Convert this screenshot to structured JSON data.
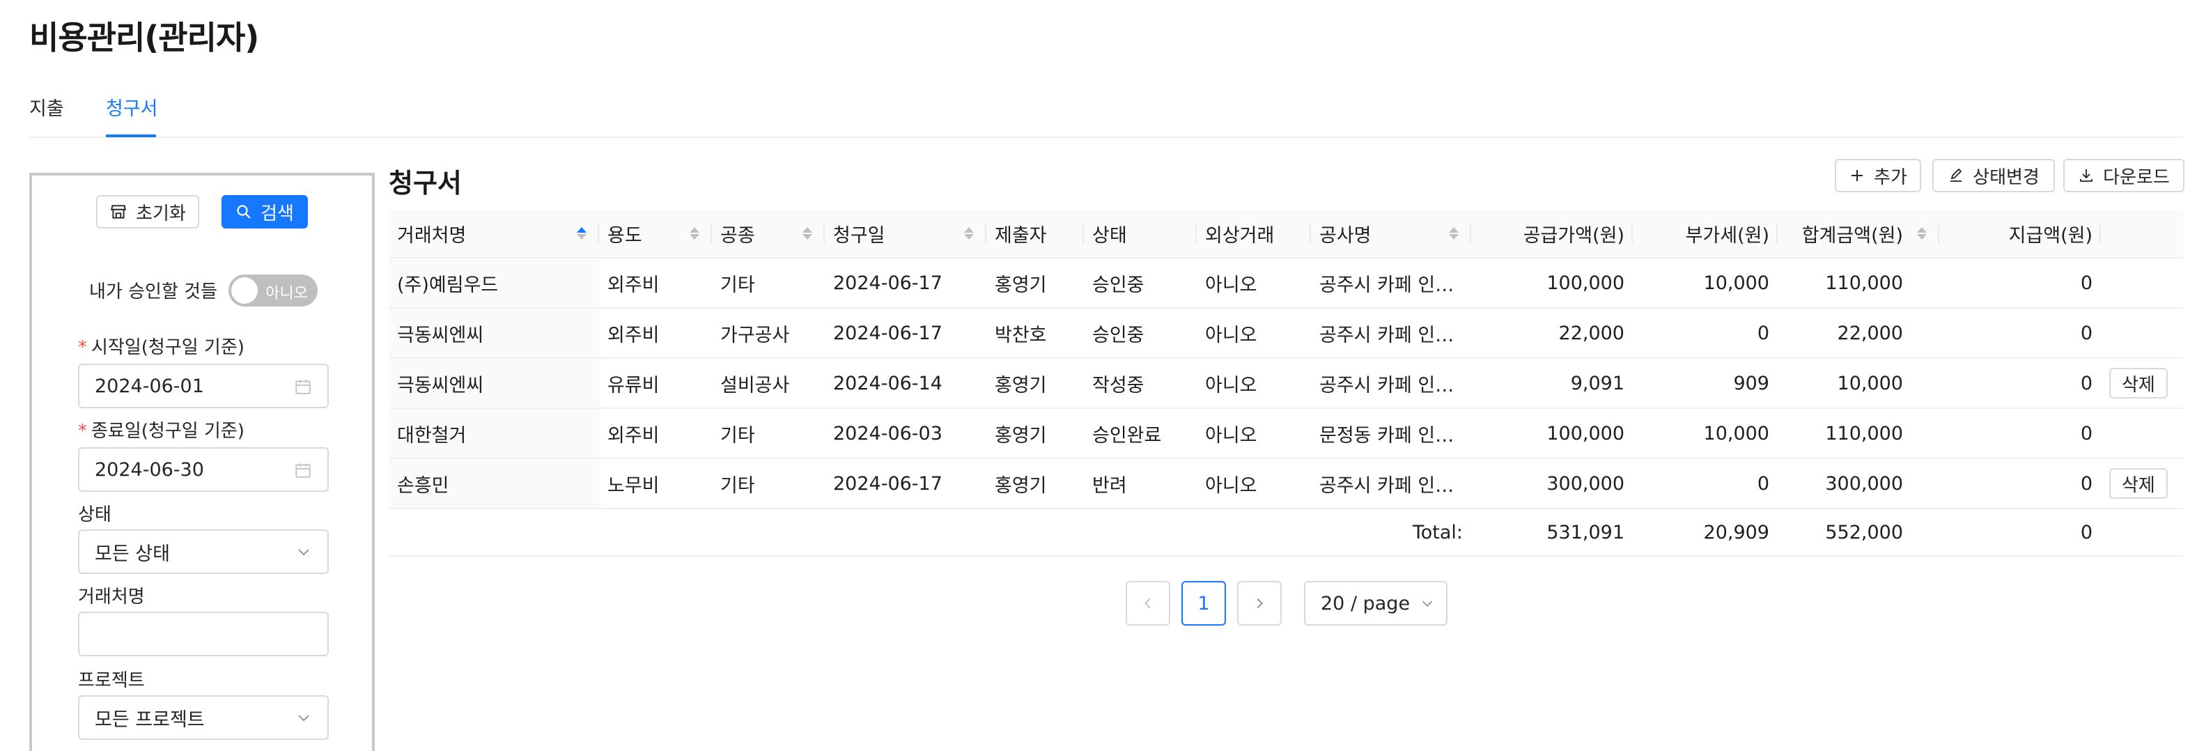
{
  "page": {
    "title": "비용관리(관리자)"
  },
  "tabs": [
    {
      "label": "지출"
    },
    {
      "label": "청구서"
    }
  ],
  "filters": {
    "reset_label": "초기화",
    "search_label": "검색",
    "my_approval_label": "내가 승인할 것들",
    "my_approval_toggle": "아니오",
    "start_label": "시작일(청구일 기준)",
    "start_value": "2024-06-01",
    "end_label": "종료일(청구일 기준)",
    "end_value": "2024-06-30",
    "status_label": "상태",
    "status_value": "모든 상태",
    "vendor_label": "거래처명",
    "vendor_value": "",
    "project_label": "프로젝트",
    "project_value": "모든 프로젝트"
  },
  "main": {
    "title": "청구서",
    "add_label": "추가",
    "status_change_label": "상태변경",
    "download_label": "다운로드"
  },
  "table": {
    "columns": [
      "거래처명",
      "용도",
      "공종",
      "청구일",
      "제출자",
      "상태",
      "외상거래",
      "공사명",
      "공급가액(원)",
      "부가세(원)",
      "합계금액(원)",
      "지급액(원)"
    ],
    "rows": [
      {
        "vendor": "(주)예림우드",
        "usage": "외주비",
        "trade": "기타",
        "date": "2024-06-17",
        "submitter": "홍영기",
        "status": "승인중",
        "credit": "아니오",
        "project": "공주시 카페 인테리어",
        "supply": "100,000",
        "vat": "10,000",
        "total": "110,000",
        "paid": "0",
        "delete_label": ""
      },
      {
        "vendor": "극동씨엔씨",
        "usage": "외주비",
        "trade": "가구공사",
        "date": "2024-06-17",
        "submitter": "박찬호",
        "status": "승인중",
        "credit": "아니오",
        "project": "공주시 카페 인테리어",
        "supply": "22,000",
        "vat": "0",
        "total": "22,000",
        "paid": "0",
        "delete_label": ""
      },
      {
        "vendor": "극동씨엔씨",
        "usage": "유류비",
        "trade": "설비공사",
        "date": "2024-06-14",
        "submitter": "홍영기",
        "status": "작성중",
        "credit": "아니오",
        "project": "공주시 카페 인테리어",
        "supply": "9,091",
        "vat": "909",
        "total": "10,000",
        "paid": "0",
        "delete_label": "삭제"
      },
      {
        "vendor": "대한철거",
        "usage": "외주비",
        "trade": "기타",
        "date": "2024-06-03",
        "submitter": "홍영기",
        "status": "승인완료",
        "credit": "아니오",
        "project": "문정동 카페 인테리어",
        "supply": "100,000",
        "vat": "10,000",
        "total": "110,000",
        "paid": "0",
        "delete_label": ""
      },
      {
        "vendor": "손흥민",
        "usage": "노무비",
        "trade": "기타",
        "date": "2024-06-17",
        "submitter": "홍영기",
        "status": "반려",
        "credit": "아니오",
        "project": "공주시 카페 인테리어",
        "supply": "300,000",
        "vat": "0",
        "total": "300,000",
        "paid": "0",
        "delete_label": "삭제"
      }
    ],
    "totals": {
      "label": "Total:",
      "supply": "531,091",
      "vat": "20,909",
      "total": "552,000",
      "paid": "0"
    }
  },
  "pagination": {
    "current": "1",
    "page_size": "20 / page"
  },
  "colors": {
    "accent": "#1677ff",
    "required": "#ff4d4f",
    "border": "#d9d9d9"
  }
}
